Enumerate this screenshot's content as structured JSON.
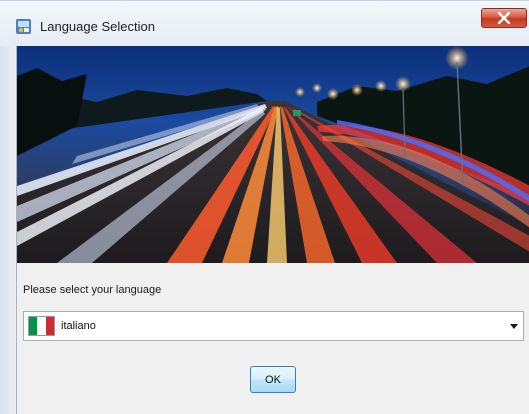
{
  "window": {
    "title": "Language Selection"
  },
  "main": {
    "prompt": "Please select your language",
    "language_select": {
      "selected": "italiano",
      "selected_flag": "italy-flag-icon"
    },
    "ok_label": "OK"
  },
  "colors": {
    "flag_green": "#009246",
    "flag_white": "#ffffff",
    "flag_red": "#ce2b37",
    "close_button": "#c8432b",
    "ok_button_border": "#3c7fb1"
  },
  "icons": {
    "app": "app-icon",
    "close": "close-icon",
    "dropdown": "chevron-down-icon"
  }
}
